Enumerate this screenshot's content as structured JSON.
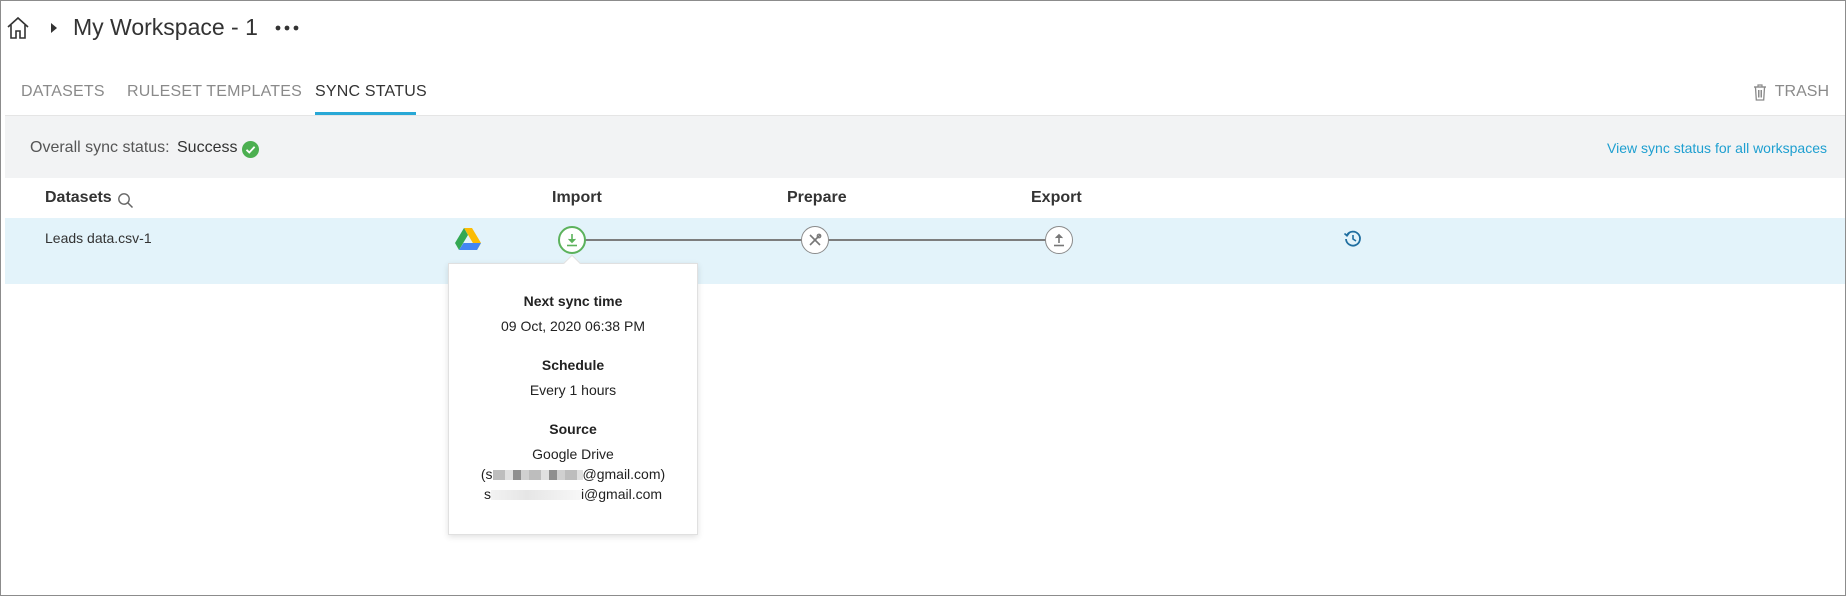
{
  "header": {
    "title": "My Workspace - 1",
    "home_icon": "home-icon",
    "more_icon": "more-horizontal-icon"
  },
  "tabs": [
    {
      "label": "DATASETS",
      "active": false
    },
    {
      "label": "RULESET TEMPLATES",
      "active": false
    },
    {
      "label": "SYNC STATUS",
      "active": true
    }
  ],
  "trash": {
    "label": "TRASH",
    "icon": "trash-icon"
  },
  "status": {
    "label": "Overall sync status:",
    "value": "Success",
    "view_all_link": "View sync status for all workspaces",
    "success_color": "#4caf50"
  },
  "table": {
    "columns": {
      "datasets": "Datasets",
      "import": "Import",
      "prepare": "Prepare",
      "export": "Export"
    },
    "rows": [
      {
        "name": "Leads data.csv-1",
        "source_icon": "google-drive-icon"
      }
    ]
  },
  "popover": {
    "next_sync_heading": "Next sync time",
    "next_sync_value": "09 Oct, 2020 06:38 PM",
    "schedule_heading": "Schedule",
    "schedule_value": "Every 1 hours",
    "source_heading": "Source",
    "source_value": "Google Drive",
    "source_account_prefix": "(s",
    "source_account_suffix": "@gmail.com)",
    "source_email_prefix": "s",
    "source_email_suffix": "i@gmail.com"
  },
  "colors": {
    "accent": "#29a8d6",
    "link": "#1e9fd0",
    "row_highlight": "#e3f3fa",
    "status_bar_bg": "#f2f3f4",
    "import_ok": "#5cb25c"
  }
}
